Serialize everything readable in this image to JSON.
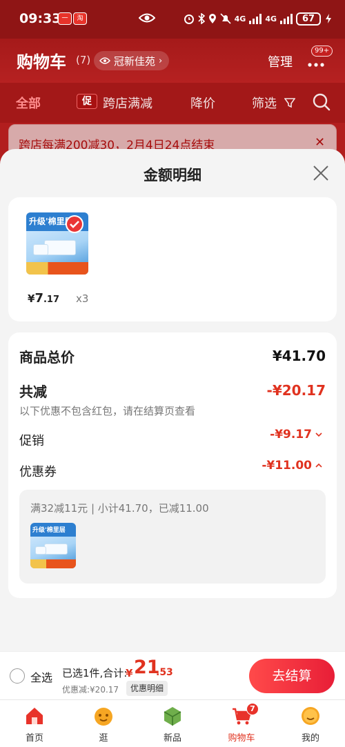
{
  "status_bar": {
    "time": "09:33",
    "app1": "一",
    "app2": "淘",
    "net1": "4G",
    "net2": "4G",
    "battery": "67"
  },
  "header": {
    "title": "购物车",
    "count": "(7)",
    "location": "冠新佳苑",
    "manage": "管理",
    "more_badge": "99+"
  },
  "filters": {
    "all": "全部",
    "promo_tag": "促",
    "cross_store": "跨店满减",
    "price_drop": "降价",
    "filter": "筛选"
  },
  "notice": {
    "text": "跨店每满200减30，2月4日24点结束"
  },
  "sheet": {
    "title": "金额明细"
  },
  "product": {
    "thumb_text": "升级'棉里层",
    "price_symbol": "¥",
    "price_int": "7",
    "price_dec": ".17",
    "qty": "x3"
  },
  "detail": {
    "total_label": "商品总价",
    "total_value": "¥41.70",
    "reduce_label": "共减",
    "reduce_value": "-¥20.17",
    "reduce_note": "以下优惠不包含红包，请在结算页查看",
    "promo_label": "促销",
    "promo_value": "-¥9.17",
    "coupon_label": "优惠券",
    "coupon_value": "-¥11.00",
    "coupon_desc": "满32减11元 | 小计41.70，已减11.00"
  },
  "bottom": {
    "select_all": "全选",
    "selected_text": "已选1件,合计:",
    "total_currency": "¥",
    "total_int": "21",
    "total_dec": ".53",
    "discount_text": "优惠减:¥20.17",
    "detail_button": "优惠明细",
    "checkout": "去结算"
  },
  "nav": {
    "items": [
      {
        "label": "首页"
      },
      {
        "label": "逛"
      },
      {
        "label": "新品"
      },
      {
        "label": "购物车"
      },
      {
        "label": "我的"
      }
    ],
    "cart_badge": "7"
  },
  "colors": {
    "brand_red": "#b21e1e",
    "price_red": "#e0321f",
    "checkout_red": "#ff4a4a"
  }
}
